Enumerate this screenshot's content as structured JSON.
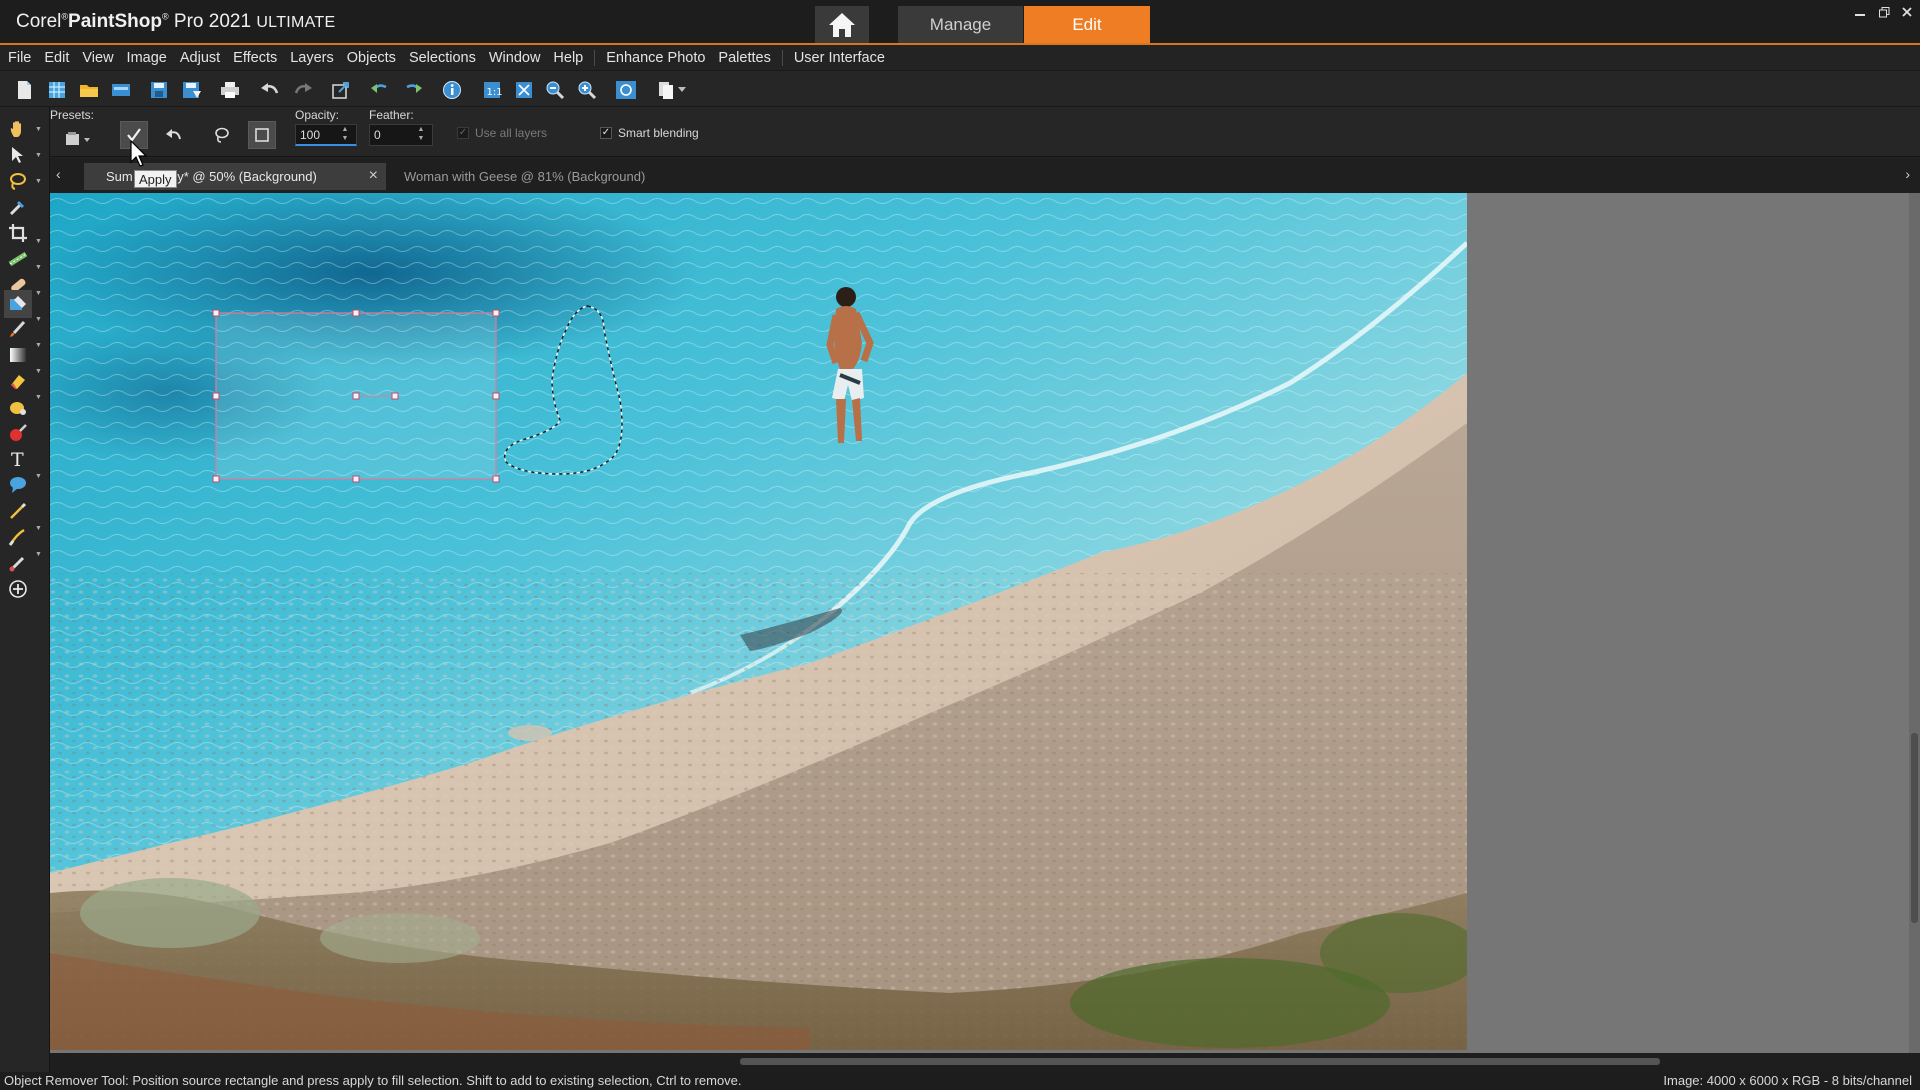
{
  "app": {
    "title_brand": "Corel",
    "title_product": "PaintShop",
    "title_pro": "Pro 2021",
    "title_edition": "ULTIMATE"
  },
  "modes": {
    "manage_label": "Manage",
    "edit_label": "Edit",
    "active": "Edit"
  },
  "menu": {
    "items": [
      "File",
      "Edit",
      "View",
      "Image",
      "Adjust",
      "Effects",
      "Layers",
      "Objects",
      "Selections",
      "Window",
      "Help"
    ],
    "extra_items": [
      "Enhance Photo",
      "Palettes",
      "User Interface"
    ]
  },
  "tool_options": {
    "presets_label": "Presets:",
    "opacity_label": "Opacity:",
    "opacity_value": "100",
    "feather_label": "Feather:",
    "feather_value": "0",
    "use_all_layers_label": "Use all layers",
    "use_all_layers_checked": true,
    "use_all_layers_enabled": false,
    "smart_blending_label": "Smart blending",
    "smart_blending_checked": true,
    "tooltip": "Apply"
  },
  "documents": {
    "active_tab": "Sum",
    "active_tab_tail": "day* @  50% (Background)",
    "inactive_tab": "Woman with Geese @  81% (Background)"
  },
  "status": {
    "message": "Object Remover Tool: Position source rectangle and press apply to fill selection. Shift to add to existing selection, Ctrl to remove.",
    "image_info": "Image:  4000 x 6000 x RGB - 8 bits/channel"
  },
  "colors": {
    "accent": "#ef7d23",
    "background": "#232323",
    "workspace": "#767676"
  },
  "icons": {
    "home": "home-icon",
    "apply": "checkmark-icon",
    "undo": "undo-icon",
    "lasso": "lasso-icon",
    "rectangle": "rectangle-select-icon"
  }
}
